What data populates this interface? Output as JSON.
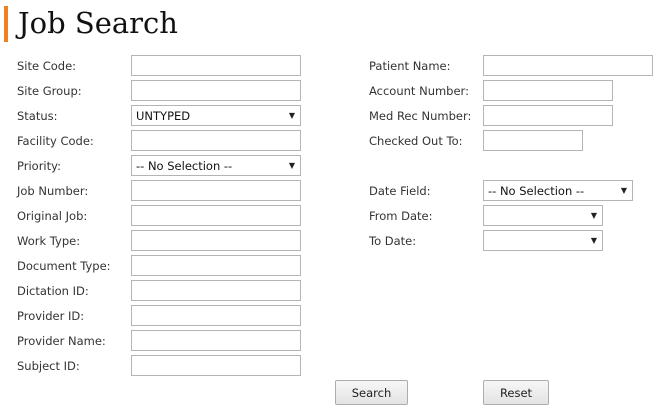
{
  "page": {
    "title": "Job Search"
  },
  "fields": {
    "site_code": {
      "label": "Site Code:",
      "value": ""
    },
    "site_group": {
      "label": "Site Group:",
      "value": ""
    },
    "status": {
      "label": "Status:",
      "value": "UNTYPED"
    },
    "facility_code": {
      "label": "Facility Code:",
      "value": ""
    },
    "priority": {
      "label": "Priority:",
      "value": "-- No Selection --"
    },
    "job_number": {
      "label": "Job Number:",
      "value": ""
    },
    "original_job": {
      "label": "Original Job:",
      "value": ""
    },
    "work_type": {
      "label": "Work Type:",
      "value": ""
    },
    "document_type": {
      "label": "Document Type:",
      "value": ""
    },
    "dictation_id": {
      "label": "Dictation ID:",
      "value": ""
    },
    "provider_id": {
      "label": "Provider ID:",
      "value": ""
    },
    "provider_name": {
      "label": "Provider Name:",
      "value": ""
    },
    "subject_id": {
      "label": "Subject ID:",
      "value": ""
    },
    "patient_name": {
      "label": "Patient Name:",
      "value": ""
    },
    "account_number": {
      "label": "Account Number:",
      "value": ""
    },
    "med_rec_number": {
      "label": "Med Rec Number:",
      "value": ""
    },
    "checked_out_to": {
      "label": "Checked Out To:",
      "value": ""
    },
    "date_field": {
      "label": "Date Field:",
      "value": "-- No Selection --"
    },
    "from_date": {
      "label": "From Date:",
      "value": ""
    },
    "to_date": {
      "label": "To Date:",
      "value": ""
    }
  },
  "icons": {
    "dropdown": "chevron-down-icon"
  },
  "colors": {
    "accent": "#f08122",
    "field_border": "#b4b4b4"
  },
  "buttons": {
    "search": "Search",
    "reset": "Reset"
  }
}
